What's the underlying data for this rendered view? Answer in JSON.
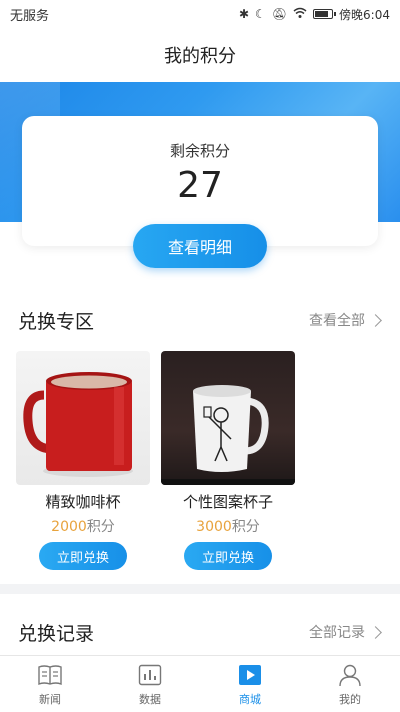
{
  "status_bar": {
    "carrier": "无服务",
    "time": "傍晚6:04"
  },
  "header": {
    "title": "我的积分"
  },
  "points_card": {
    "label": "剩余积分",
    "value": "27",
    "detail_button": "查看明细"
  },
  "exchange_section": {
    "title": "兑换专区",
    "view_all": "查看全部",
    "products": [
      {
        "name": "精致咖啡杯",
        "points": "2000",
        "unit": "积分",
        "button": "立即兑换"
      },
      {
        "name": "个性图案杯子",
        "points": "3000",
        "unit": "积分",
        "button": "立即兑换"
      }
    ]
  },
  "records_section": {
    "title": "兑换记录",
    "view_all": "全部记录"
  },
  "tab_bar": {
    "items": [
      {
        "label": "新闻",
        "icon": "news-icon",
        "active": false
      },
      {
        "label": "数据",
        "icon": "chart-icon",
        "active": false
      },
      {
        "label": "商城",
        "icon": "mall-icon",
        "active": true
      },
      {
        "label": "我的",
        "icon": "profile-icon",
        "active": false
      }
    ]
  },
  "colors": {
    "accent": "#1a8fe8",
    "points_highlight": "#e8a33d"
  }
}
